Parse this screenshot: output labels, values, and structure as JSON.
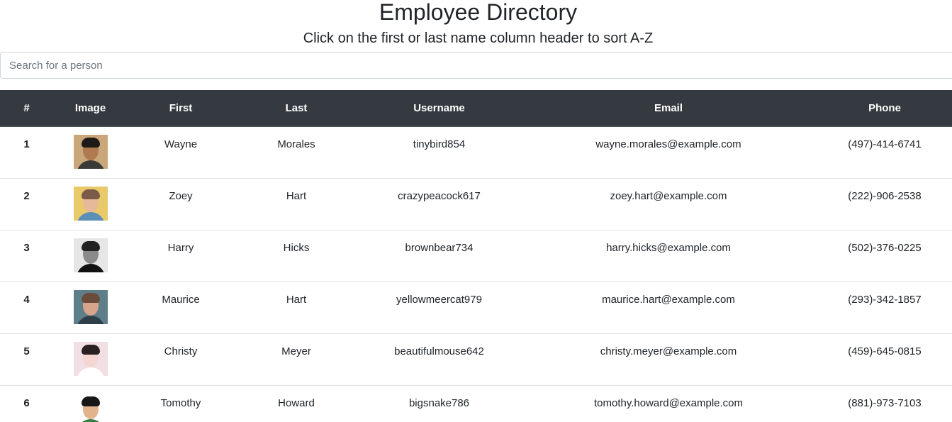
{
  "page": {
    "title": "Employee Directory",
    "subtitle": "Click on the first or last name column header to sort A-Z"
  },
  "search": {
    "placeholder": "Search for a person",
    "value": ""
  },
  "table": {
    "columns": [
      "#",
      "Image",
      "First",
      "Last",
      "Username",
      "Email",
      "Phone"
    ],
    "rows": [
      {
        "num": "1",
        "first": "Wayne",
        "last": "Morales",
        "username": "tinybird854",
        "email": "wayne.morales@example.com",
        "phone": "(497)-414-6741",
        "avatar": {
          "bg": "#c9a77a",
          "skin": "#b0794f",
          "hair": "#1e1a17",
          "shirt": "#3b3a36"
        }
      },
      {
        "num": "2",
        "first": "Zoey",
        "last": "Hart",
        "username": "crazypeacock617",
        "email": "zoey.hart@example.com",
        "phone": "(222)-906-2538",
        "avatar": {
          "bg": "#e9c96a",
          "skin": "#e7b99b",
          "hair": "#7b5a4a",
          "shirt": "#5a8fb8"
        }
      },
      {
        "num": "3",
        "first": "Harry",
        "last": "Hicks",
        "username": "brownbear734",
        "email": "harry.hicks@example.com",
        "phone": "(502)-376-0225",
        "avatar": {
          "bg": "#e6e6e6",
          "skin": "#8a8a8a",
          "hair": "#222222",
          "shirt": "#111111"
        }
      },
      {
        "num": "4",
        "first": "Maurice",
        "last": "Hart",
        "username": "yellowmeercat979",
        "email": "maurice.hart@example.com",
        "phone": "(293)-342-1857",
        "avatar": {
          "bg": "#5e7f8a",
          "skin": "#d8a48c",
          "hair": "#6b4c3b",
          "shirt": "#2f3f4a"
        }
      },
      {
        "num": "5",
        "first": "Christy",
        "last": "Meyer",
        "username": "beautifulmouse642",
        "email": "christy.meyer@example.com",
        "phone": "(459)-645-0815",
        "avatar": {
          "bg": "#f1dfe3",
          "skin": "#f2d6cf",
          "hair": "#2a2020",
          "shirt": "#ffffff"
        }
      },
      {
        "num": "6",
        "first": "Tomothy",
        "last": "Howard",
        "username": "bigsnake786",
        "email": "tomothy.howard@example.com",
        "phone": "(881)-973-7103",
        "avatar": {
          "bg": "#ffffff",
          "skin": "#e2b48c",
          "hair": "#171717",
          "shirt": "#3a7d44"
        }
      }
    ]
  },
  "colors": {
    "header_bg": "#343a40",
    "header_text": "#ffffff",
    "row_border": "#dee2e6",
    "text": "#212529"
  },
  "icons": {
    "avatar": "employee-photo"
  }
}
